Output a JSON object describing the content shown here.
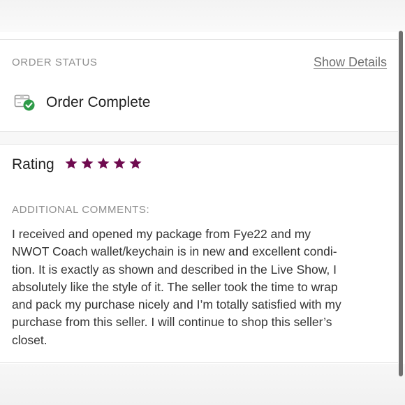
{
  "order_status": {
    "section_label": "ORDER STATUS",
    "show_details_label": "Show Details",
    "status_text": "Order Complete",
    "status_icon": "package-check-icon"
  },
  "rating": {
    "label": "Rating",
    "stars": 5,
    "max_stars": 5,
    "star_color": "#6f0b4f"
  },
  "comments": {
    "section_label": "ADDITIONAL COMMENTS:",
    "text": "I received and opened my package from Fye22 and my\nNWOT Coach wallet/keychain is in new and excellent condi-\ntion. It is exactly as shown and described in the Live Show, I\nabsolutely like the style of it. The seller took the time to wrap\nand pack my purchase nicely and I’m totally satisfied with my\npurchase from this seller. I will continue to shop this seller’s\ncloset."
  },
  "colors": {
    "check_green": "#2e9b48",
    "label_gray": "#8e8e8e",
    "text_dark": "#222222"
  }
}
